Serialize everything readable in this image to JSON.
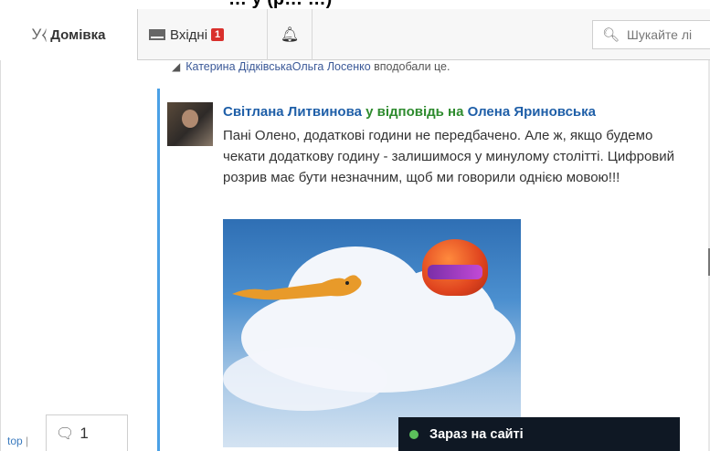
{
  "header": {
    "top_title_fragment": "… у (р… …)",
    "home_logo": "У⧼",
    "home_label": "Домівка",
    "inbox_label": "Вхідні",
    "inbox_count": "1",
    "search_placeholder": "Шукайте лі"
  },
  "likes": {
    "name1": "Катерина Дідківська",
    "name2": "Ольга Лосенко",
    "suffix": " вподобали це."
  },
  "comment": {
    "author": "Світлана Литвинова",
    "reply_phrase": " у відповідь на ",
    "target": "Олена Яриновська",
    "text": "Пані Олено, додаткові години не передбачено. Але ж, якщо будемо чекати додаткову годину - залишимося у минулому столітті. Цифровий розрив має бути незначним, щоб ми говорили однією мовою!!!"
  },
  "footer": {
    "top_link": "top",
    "separator": " |",
    "chat_count": "1",
    "online_label": "Зараз на сайті"
  },
  "colors": {
    "author": "#1f5fa8",
    "reply": "#2e8b2e",
    "thread_line": "#4aa0e6",
    "badge": "#d9302c",
    "online_bg": "#0f1824",
    "online_dot": "#5cc05c"
  }
}
